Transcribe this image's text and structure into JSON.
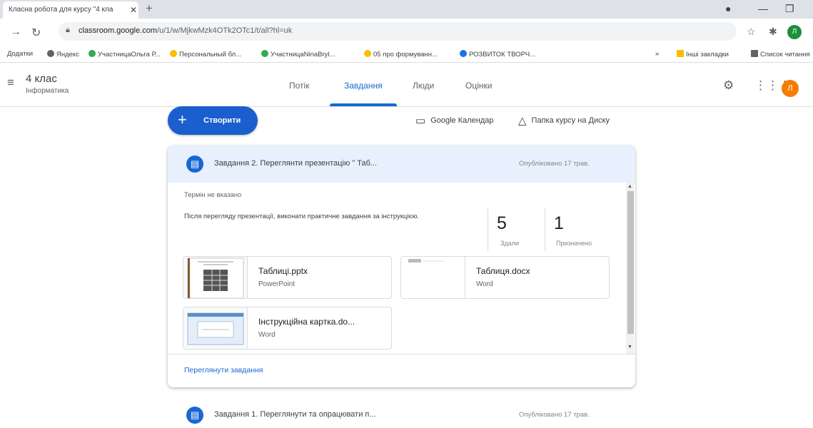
{
  "browser": {
    "tab_title": "Класна робота для курсу \"4 кла",
    "tab_close": "✕",
    "new_tab": "+",
    "url_host": "classroom.google.com",
    "url_path": "/u/1/w/MjkwMzk4OTk2OTc1/t/all?hl=uk",
    "bookmarks": [
      {
        "label": "Додатки",
        "color": "#5f6368"
      },
      {
        "label": "Яндекс",
        "color": "#5f6368"
      },
      {
        "label": "УчастницаОльга Р...",
        "color": "#34a853"
      },
      {
        "label": "Персональный бл...",
        "color": "#fbbc04"
      },
      {
        "label": "УчастницаNinaBryl...",
        "color": "#34a853"
      },
      {
        "label": "05 про формуванн...",
        "color": "#fbbc04"
      },
      {
        "label": "РОЗВИТОК ТВОРЧ...",
        "color": "#1a73e8"
      }
    ],
    "bookmarks_more": "»",
    "other_bookmarks": "Інші закладки",
    "reading_list": "Список читання"
  },
  "header": {
    "class_name": "4 клас",
    "subject": "Інформатика",
    "tabs": [
      {
        "label": "Потік",
        "active": false
      },
      {
        "label": "Завдання",
        "active": true
      },
      {
        "label": "Люди",
        "active": false
      },
      {
        "label": "Оцінки",
        "active": false
      }
    ],
    "avatar_letter": "Л",
    "avatar_color": "#f57c00"
  },
  "toolbar": {
    "create_label": "Створити",
    "calendar_label": "Google Календар",
    "drive_label": "Папка курсу на Диску"
  },
  "assignment1": {
    "title": "Завдання 2. Переглянти презентацію \" Таб...",
    "posted": "Опубліковано 17 трав.",
    "due": "Термін не вказано",
    "description": "Після перегляду презентації, виконати практичне завдання за інструкцією.",
    "stats": {
      "handed_in": "5",
      "handed_in_label": "Здали",
      "assigned": "1",
      "assigned_label": "Призначено"
    },
    "attachments": [
      {
        "name": "Таблиці.pptx",
        "type": "PowerPoint"
      },
      {
        "name": "Таблиця.docx",
        "type": "Word"
      },
      {
        "name": "Інструкційна картка.do...",
        "type": "Word"
      }
    ],
    "view_link": "Переглянути завдання"
  },
  "assignment2": {
    "title": "Завдання 1. Переглянути та опрацювати п...",
    "posted": "Опубліковано 17 трав."
  },
  "colors": {
    "accent": "#1967d2",
    "create_button": "#1a5fcd",
    "card_header": "#e8f0fe"
  }
}
